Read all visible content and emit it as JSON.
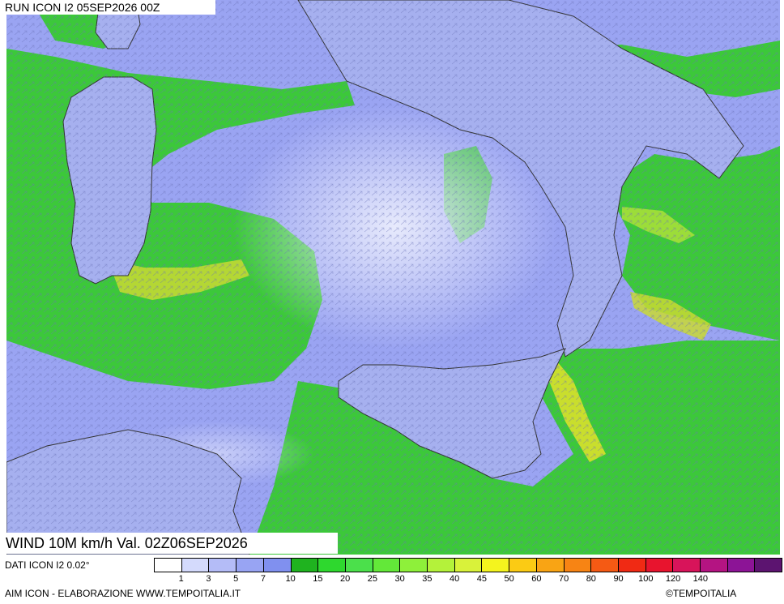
{
  "header": {
    "run_label": "RUN ICON I2 05SEP2026 00Z"
  },
  "map": {
    "valid_label": "WIND 10M km/h Val. 02Z06SEP2026",
    "land_color": "#a6b0ef",
    "sea_calm_color": "#c7cdf5",
    "sea_wind_color": "#3cc83a",
    "jet_color": "#d8e02c",
    "coast_color": "#333333"
  },
  "footer": {
    "dati_label": "DATI ICON I2 0.02°",
    "aim_label": "AIM ICON - ELABORAZIONE WWW.TEMPOITALIA.IT",
    "copyright_label": "©TEMPOITALIA"
  },
  "legend": {
    "colors": [
      "#ffffff",
      "#d4dafc",
      "#b4bcf7",
      "#98a4f3",
      "#8090ef",
      "#1fb31f",
      "#2ed82e",
      "#4be04b",
      "#63e839",
      "#8ef03a",
      "#b4f23a",
      "#d9f23a",
      "#f4f41e",
      "#fbcb14",
      "#f9a414",
      "#f78414",
      "#f55a14",
      "#f02a14",
      "#e8142e",
      "#d8145a",
      "#b41482",
      "#8c1496",
      "#5c1470"
    ],
    "ticks": [
      "1",
      "3",
      "5",
      "7",
      "10",
      "15",
      "20",
      "25",
      "30",
      "35",
      "40",
      "45",
      "50",
      "60",
      "70",
      "80",
      "90",
      "100",
      "120",
      "140"
    ]
  }
}
